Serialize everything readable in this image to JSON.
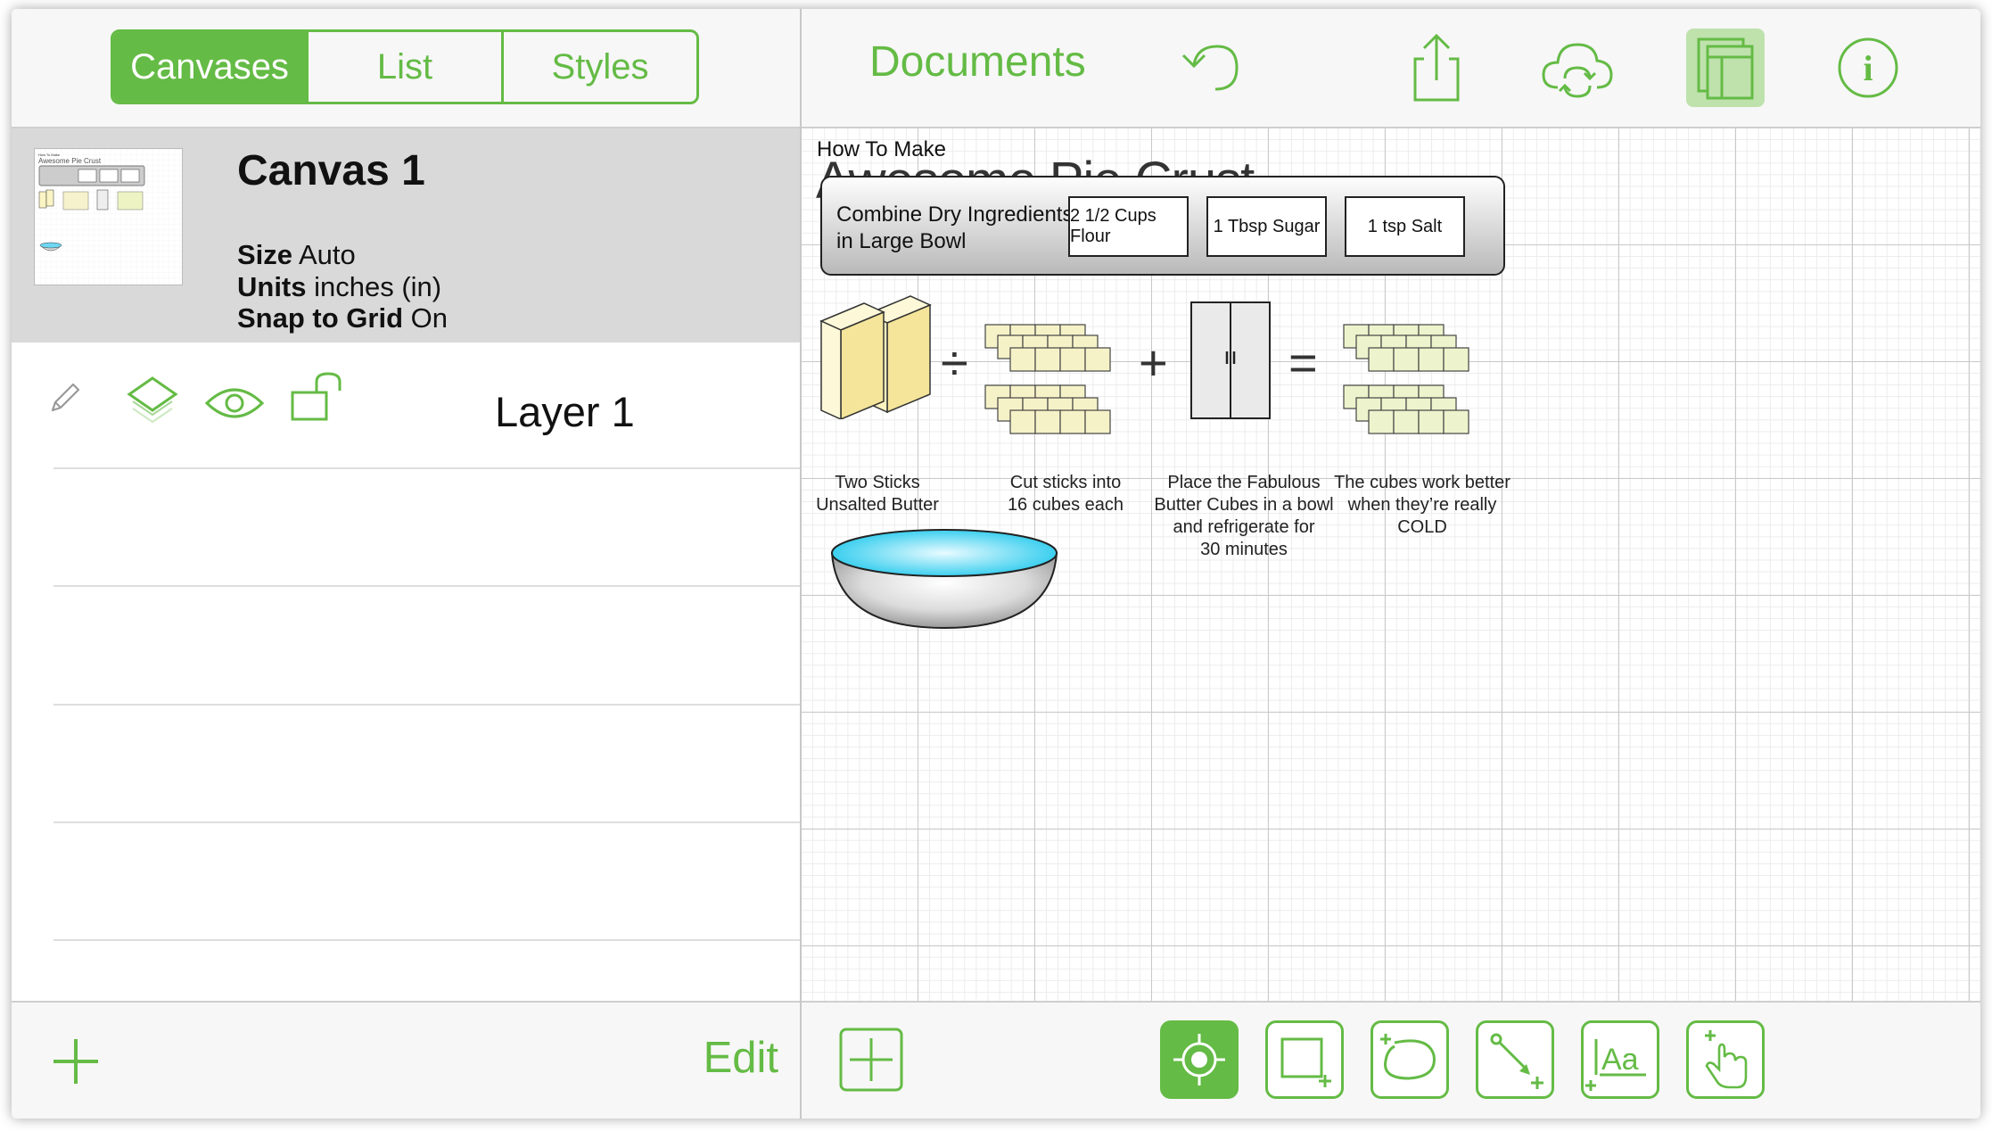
{
  "sidebar": {
    "tabs": [
      {
        "label": "Canvases"
      },
      {
        "label": "List"
      },
      {
        "label": "Styles"
      }
    ],
    "canvas": {
      "name": "Canvas 1",
      "size_label": "Size",
      "size_value": "Auto",
      "units_label": "Units",
      "units_value": "inches (in)",
      "snap_label": "Snap to Grid",
      "snap_value": "On"
    },
    "layer": {
      "name": "Layer 1"
    },
    "footer": {
      "add_icon": "plus-icon",
      "edit_label": "Edit"
    }
  },
  "header": {
    "documents_label": "Documents",
    "icons": [
      "undo-icon",
      "share-icon",
      "cloud-sync-icon",
      "sidebar-toggle-icon",
      "info-icon"
    ]
  },
  "document": {
    "title_small": "How To Make",
    "title_large": "Awesome Pie Crust",
    "banner": {
      "text_line1": "Combine Dry Ingredients",
      "text_line2": "in Large Bowl",
      "items": [
        "2 1/2 Cups Flour",
        "1 Tbsp Sugar",
        "1 tsp Salt"
      ]
    },
    "operators": [
      "÷",
      "+",
      "="
    ],
    "captions": [
      {
        "lines": [
          "Two Sticks",
          "Unsalted Butter"
        ]
      },
      {
        "lines": [
          "Cut sticks into",
          "16 cubes each"
        ]
      },
      {
        "lines": [
          "Place the Fabulous",
          "Butter Cubes in a bowl",
          "and refrigerate for",
          "30 minutes"
        ]
      },
      {
        "lines": [
          "The cubes work better",
          "when they’re really",
          "COLD"
        ]
      }
    ]
  },
  "toolbar": {
    "tools": [
      "selection-tool-icon",
      "shape-tool-icon",
      "freehand-tool-icon",
      "line-tool-icon",
      "text-tool-icon",
      "touch-tool-icon"
    ],
    "add_icon": "add-canvas-icon"
  },
  "colors": {
    "accent": "#64bb45",
    "selected_row": "#d9d9d9",
    "bar": "#f7f7f7"
  }
}
